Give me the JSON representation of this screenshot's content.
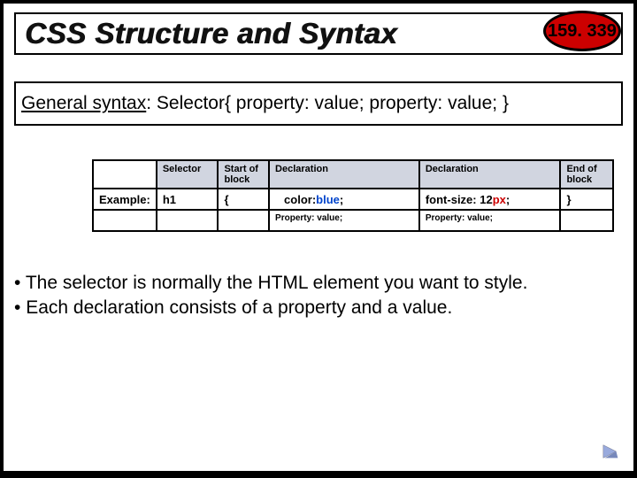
{
  "title": "CSS Structure and Syntax",
  "badge": "159. 339",
  "syntax": {
    "lead": "General syntax",
    "rest": ":  Selector{ property: value; property: value; }"
  },
  "table": {
    "headers": {
      "selector": "Selector",
      "startblock": "Start of block",
      "decl1": "Declaration",
      "decl2": "Declaration",
      "endblock": "End of block"
    },
    "example": {
      "label": "Example:",
      "selector": "h1",
      "start": "{",
      "decl1_prefix": "color:",
      "decl1_val": "blue",
      "decl1_suffix": ";",
      "decl2_prefix": "font-size: 12",
      "decl2_val": "px",
      "decl2_suffix": ";",
      "end": "}"
    },
    "footer": {
      "pv1": "Property: value;",
      "pv2": "Property: value;"
    }
  },
  "bullets": {
    "b1": "The selector is normally the HTML element you want to style.",
    "b2": "Each declaration consists of a property and a value."
  }
}
